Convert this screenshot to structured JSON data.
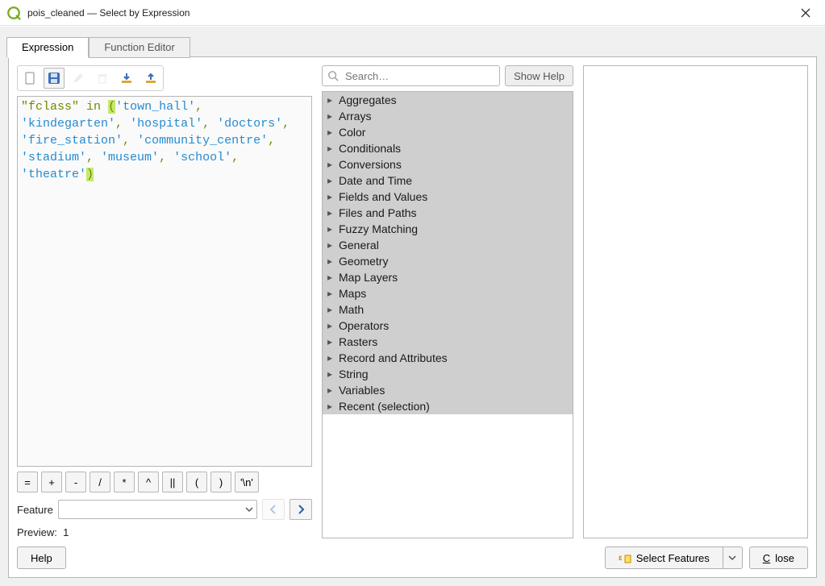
{
  "window": {
    "title": "pois_cleaned — Select by Expression"
  },
  "tabs": [
    {
      "label": "Expression",
      "active": true
    },
    {
      "label": "Function Editor",
      "active": false
    }
  ],
  "expression_tokens": [
    {
      "t": "field",
      "v": "\"fclass\""
    },
    {
      "t": "sp",
      "v": " "
    },
    {
      "t": "keyword",
      "v": "in"
    },
    {
      "t": "sp",
      "v": " "
    },
    {
      "t": "hlparen",
      "v": "("
    },
    {
      "t": "string",
      "v": "'town_hall'"
    },
    {
      "t": "punct",
      "v": ","
    },
    {
      "t": "sp",
      "v": " "
    },
    {
      "t": "string",
      "v": "'kindegarten'"
    },
    {
      "t": "punct",
      "v": ","
    },
    {
      "t": "sp",
      "v": " "
    },
    {
      "t": "string",
      "v": "'hospital'"
    },
    {
      "t": "punct",
      "v": ","
    },
    {
      "t": "sp",
      "v": " "
    },
    {
      "t": "string",
      "v": "'doctors'"
    },
    {
      "t": "punct",
      "v": ","
    },
    {
      "t": "sp",
      "v": " "
    },
    {
      "t": "string",
      "v": "'fire_station'"
    },
    {
      "t": "punct",
      "v": ","
    },
    {
      "t": "sp",
      "v": " "
    },
    {
      "t": "string",
      "v": "'community_centre'"
    },
    {
      "t": "punct",
      "v": ","
    },
    {
      "t": "sp",
      "v": " "
    },
    {
      "t": "string",
      "v": "'stadium'"
    },
    {
      "t": "punct",
      "v": ","
    },
    {
      "t": "sp",
      "v": " "
    },
    {
      "t": "string",
      "v": "'museum'"
    },
    {
      "t": "punct",
      "v": ","
    },
    {
      "t": "sp",
      "v": " "
    },
    {
      "t": "string",
      "v": "'school'"
    },
    {
      "t": "punct",
      "v": ","
    },
    {
      "t": "sp",
      "v": " "
    },
    {
      "t": "string",
      "v": "'theatre'"
    },
    {
      "t": "hlparen",
      "v": ")"
    }
  ],
  "operator_buttons": [
    "=",
    "+",
    "-",
    "/",
    "*",
    "^",
    "||",
    "(",
    ")",
    "'\\n'"
  ],
  "feature": {
    "label": "Feature",
    "value": ""
  },
  "preview": {
    "label": "Preview:",
    "value": "1"
  },
  "search": {
    "placeholder": "Search…",
    "help_label": "Show Help"
  },
  "categories": [
    "Aggregates",
    "Arrays",
    "Color",
    "Conditionals",
    "Conversions",
    "Date and Time",
    "Fields and Values",
    "Files and Paths",
    "Fuzzy Matching",
    "General",
    "Geometry",
    "Map Layers",
    "Maps",
    "Math",
    "Operators",
    "Rasters",
    "Record and Attributes",
    "String",
    "Variables",
    "Recent (selection)"
  ],
  "footer": {
    "help": "Help",
    "select_features": "Select Features",
    "close": "Close"
  },
  "colors": {
    "accent": "#6d8b00",
    "string": "#258bd2",
    "paren_highlight": "#c4e86b"
  }
}
